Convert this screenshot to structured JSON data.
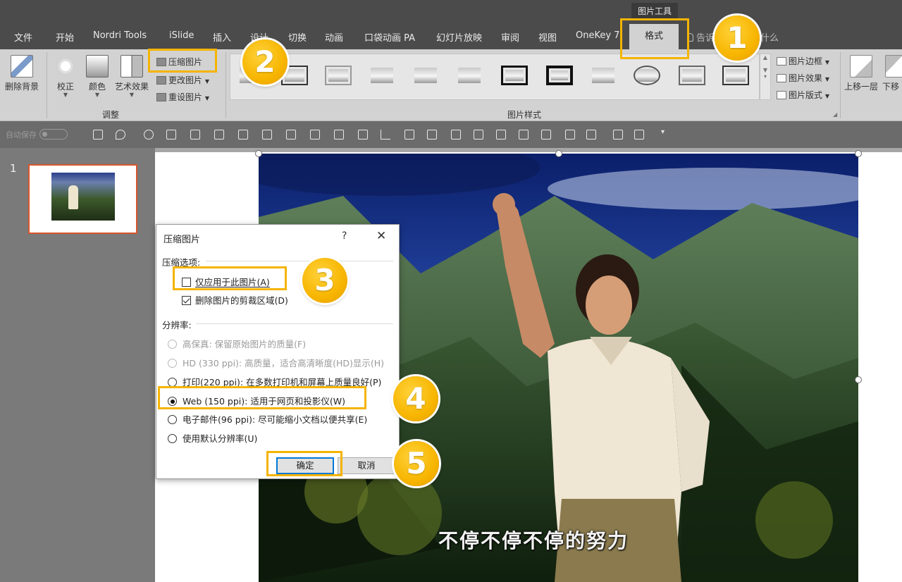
{
  "window": {
    "context_tab_group": "图片工具",
    "tabs": [
      "文件",
      "开始",
      "Nordri Tools",
      "iSlide",
      "插入",
      "设计",
      "切换",
      "动画",
      "口袋动画 PA",
      "幻灯片放映",
      "审阅",
      "视图",
      "OneKey 7"
    ],
    "active_tab": "格式",
    "tell_me": "告诉我你想要做什么"
  },
  "ribbon": {
    "adjust": {
      "remove_bg": "删除背景",
      "correct": "校正",
      "color": "颜色",
      "artistic": "艺术效果",
      "compress": "压缩图片",
      "change": "更改图片",
      "reset": "重设图片",
      "group_label": "调整"
    },
    "styles": {
      "group_label": "图片样式",
      "border": "图片边框",
      "effects": "图片效果",
      "layout": "图片版式"
    },
    "arrange": {
      "bring_forward": "上移一层",
      "send_backward": "下移"
    }
  },
  "quick_access": {
    "autosave": "自动保存",
    "autosave_state": "关"
  },
  "slides": {
    "current_number": "1"
  },
  "slide_content": {
    "caption": "不停不停不停的努力"
  },
  "dialog": {
    "title": "压缩图片",
    "help": "?",
    "close": "✕",
    "compress_options_label": "压缩选项:",
    "apply_only_this": "仅应用于此图片(A)",
    "apply_only_this_checked": false,
    "delete_cropped": "删除图片的剪裁区域(D)",
    "delete_cropped_checked": true,
    "resolution_label": "分辨率:",
    "resolutions": [
      {
        "label": "高保真: 保留原始图片的质量(F)",
        "enabled": false,
        "selected": false
      },
      {
        "label": "HD (330 ppi): 高质量，适合高清晰度(HD)显示(H)",
        "enabled": false,
        "selected": false
      },
      {
        "label": "打印(220 ppi): 在多数打印机和屏幕上质量良好(P)",
        "enabled": true,
        "selected": false
      },
      {
        "label": "Web (150 ppi): 适用于网页和投影仪(W)",
        "enabled": true,
        "selected": true
      },
      {
        "label": "电子邮件(96 ppi): 尽可能缩小文档以便共享(E)",
        "enabled": true,
        "selected": false
      },
      {
        "label": "使用默认分辨率(U)",
        "enabled": true,
        "selected": false
      }
    ],
    "ok": "确定",
    "cancel": "取消"
  },
  "annotations": {
    "step1": "1",
    "step2": "2",
    "step3": "3",
    "step4": "4",
    "step5": "5",
    "highlight_color": "#f5b400"
  }
}
